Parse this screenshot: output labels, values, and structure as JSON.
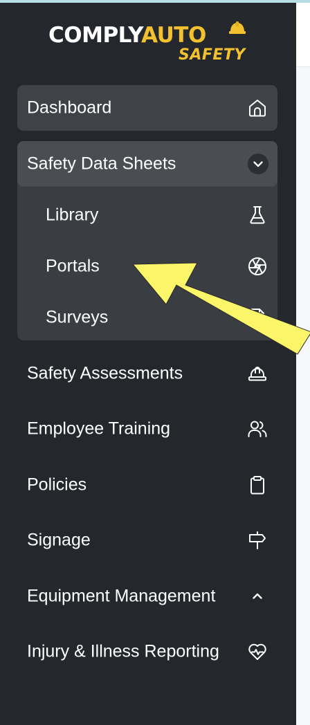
{
  "brand": {
    "logo_text_white": "COMPLY",
    "logo_text_yellow": "AUT",
    "logo_text_last": "O",
    "logo_sub": "SAFETY",
    "white": "#ffffff",
    "yellow": "#f3c130"
  },
  "colors": {
    "sidebar_bg": "#24272c",
    "item_bg": "#3f4247",
    "group_bg": "#3a3d42",
    "active_bg": "#4a4d52",
    "arrow": "#fbf56a"
  },
  "nav": {
    "dashboard": {
      "label": "Dashboard",
      "icon": "home-icon"
    },
    "sds": {
      "label": "Safety Data Sheets",
      "icon": "chevron-down-icon",
      "expanded": true,
      "children": [
        {
          "label": "Library",
          "icon": "flask-icon"
        },
        {
          "label": "Portals",
          "icon": "aperture-icon"
        },
        {
          "label": "Surveys",
          "icon": "document-icon"
        }
      ]
    },
    "assessments": {
      "label": "Safety Assessments",
      "icon": "hard-hat-icon"
    },
    "training": {
      "label": "Employee Training",
      "icon": "users-icon"
    },
    "policies": {
      "label": "Policies",
      "icon": "clipboard-icon"
    },
    "signage": {
      "label": "Signage",
      "icon": "signpost-icon"
    },
    "equipment": {
      "label": "Equipment Management",
      "icon": "chevron-up-icon"
    },
    "injury": {
      "label": "Injury & Illness Reporting",
      "icon": "heart-pulse-icon"
    }
  }
}
